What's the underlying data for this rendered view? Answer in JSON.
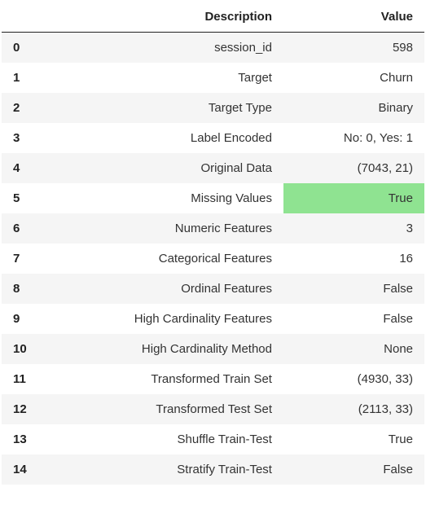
{
  "headers": {
    "description": "Description",
    "value": "Value"
  },
  "rows": [
    {
      "index": "0",
      "description": "session_id",
      "value": "598",
      "highlight": false
    },
    {
      "index": "1",
      "description": "Target",
      "value": "Churn",
      "highlight": false
    },
    {
      "index": "2",
      "description": "Target Type",
      "value": "Binary",
      "highlight": false
    },
    {
      "index": "3",
      "description": "Label Encoded",
      "value": "No: 0, Yes: 1",
      "highlight": false
    },
    {
      "index": "4",
      "description": "Original Data",
      "value": "(7043, 21)",
      "highlight": false
    },
    {
      "index": "5",
      "description": "Missing Values",
      "value": "True",
      "highlight": true
    },
    {
      "index": "6",
      "description": "Numeric Features",
      "value": "3",
      "highlight": false
    },
    {
      "index": "7",
      "description": "Categorical Features",
      "value": "16",
      "highlight": false
    },
    {
      "index": "8",
      "description": "Ordinal Features",
      "value": "False",
      "highlight": false
    },
    {
      "index": "9",
      "description": "High Cardinality Features",
      "value": "False",
      "highlight": false
    },
    {
      "index": "10",
      "description": "High Cardinality Method",
      "value": "None",
      "highlight": false
    },
    {
      "index": "11",
      "description": "Transformed Train Set",
      "value": "(4930, 33)",
      "highlight": false
    },
    {
      "index": "12",
      "description": "Transformed Test Set",
      "value": "(2113, 33)",
      "highlight": false
    },
    {
      "index": "13",
      "description": "Shuffle Train-Test",
      "value": "True",
      "highlight": false
    },
    {
      "index": "14",
      "description": "Stratify Train-Test",
      "value": "False",
      "highlight": false
    }
  ]
}
